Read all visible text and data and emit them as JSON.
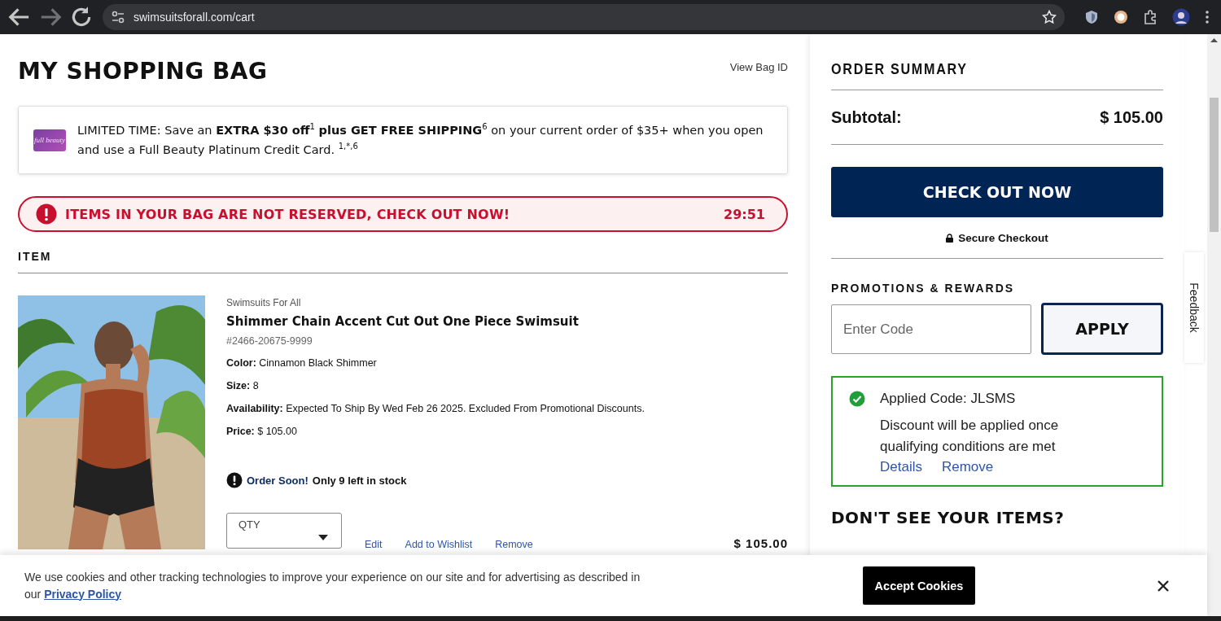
{
  "browser": {
    "url": "swimsuitsforall.com/cart"
  },
  "page": {
    "title": "MY SHOPPING BAG",
    "view_bag_id": "View Bag ID"
  },
  "promo_banner": {
    "logo": "full beauty",
    "text": "LIMITED TIME: Save an **EXTRA $30 off**$^{1}$ **plus GET FREE SHIPPING**$^{6}$ on your current order of $35+ when you open and use a Full Beauty Platinum Credit Card. $^{1,*,6}$"
  },
  "reservation_alert": {
    "text": "ITEMS IN YOUR BAG ARE NOT RESERVED, CHECK OUT NOW!",
    "timer": "29:51"
  },
  "items_header": "ITEM",
  "items": [
    {
      "kind": "picture",
      "brand": "Swimsuits For All",
      "name": "Shimmer Chain Accent Cut Out One Piece Swimsuit",
      "sku": "#2466-20675-9999",
      "details": [
        {
          "label": "Color:",
          "value": "Cinnamon Black Shimmer"
        },
        {
          "label": "Size:",
          "value": "8"
        },
        {
          "label": "Availability:",
          "value": "Expected To Ship By Wed Feb 26 2025. Excluded From Promotional Discounts."
        },
        {
          "label": "Price:",
          "value": "$ 105.00"
        }
      ],
      "stock_notice": {
        "urgent": "Order Soon!",
        "text": "Only 9 left in stock"
      },
      "qty_label": "QTY",
      "actions": [
        "Edit",
        "Add to Wishlist",
        "Remove"
      ],
      "total": "$ 105.00"
    }
  ],
  "order_summary": {
    "title": "ORDER SUMMARY",
    "subtotal_label": "Subtotal:",
    "subtotal": "$ 105.00",
    "checkout_button": "CHECK OUT NOW",
    "secure_text": "Secure Checkout",
    "promotions": {
      "title": "PROMOTIONS & REWARDS",
      "placeholder": "Enter Code",
      "apply_button": "APPLY",
      "applied": {
        "code": "Applied Code: JLSMS",
        "message": "Discount will be applied once qualifying conditions are met",
        "links": [
          "Details",
          "Remove"
        ]
      }
    },
    "missing_items_title": "DON'T SEE YOUR ITEMS?"
  },
  "feedback_tab": "Feedback",
  "cookie_banner": {
    "text": "We use cookies and other tracking technologies to improve your experience on our site and for advertising as described in our",
    "link": "Privacy Policy",
    "accept_button": "Accept Cookies"
  }
}
